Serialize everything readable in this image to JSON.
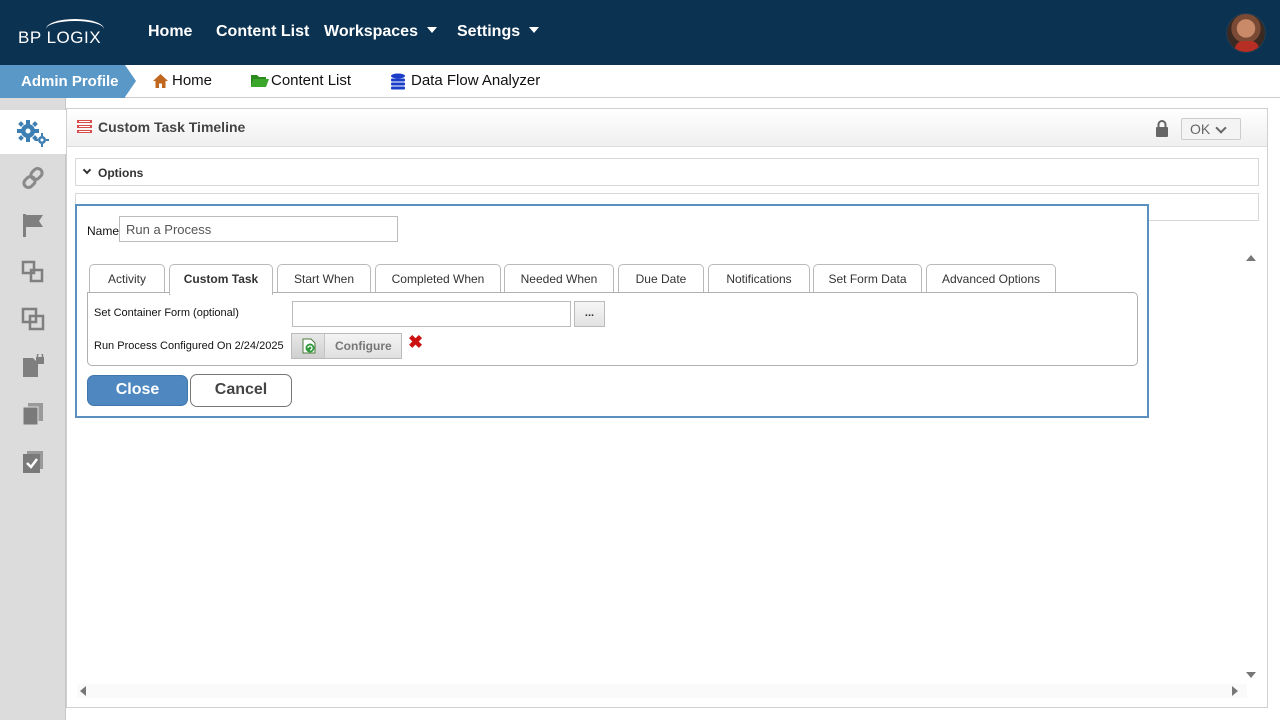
{
  "topnav": {
    "logo_text": "BP LOGIX",
    "items": [
      {
        "label": "Home"
      },
      {
        "label": "Content List"
      },
      {
        "label": "Workspaces"
      },
      {
        "label": "Settings"
      }
    ]
  },
  "breadcrumb": {
    "profile": "Admin Profile",
    "items": [
      {
        "label": "Home",
        "icon": "home-icon"
      },
      {
        "label": "Content List",
        "icon": "folder-open-icon"
      },
      {
        "label": "Data Flow Analyzer",
        "icon": "database-icon"
      }
    ]
  },
  "sidebar": {
    "icons": [
      "gears-icon",
      "link-icon",
      "flag-icon",
      "move-icon",
      "copy-layers-icon",
      "locked-document-icon",
      "documents-icon",
      "checked-document-icon"
    ]
  },
  "panel": {
    "title": "Custom Task Timeline",
    "ok_label": "OK",
    "options_label": "Options"
  },
  "dialog": {
    "name_label": "Name",
    "name_value": "Run a Process",
    "tabs": [
      {
        "label": "Activity"
      },
      {
        "label": "Custom Task",
        "active": true
      },
      {
        "label": "Start When"
      },
      {
        "label": "Completed When"
      },
      {
        "label": "Needed When"
      },
      {
        "label": "Due Date"
      },
      {
        "label": "Notifications"
      },
      {
        "label": "Set Form Data"
      },
      {
        "label": "Advanced Options"
      }
    ],
    "container_form_label": "Set Container Form (optional)",
    "container_form_value": "",
    "browse_label": "...",
    "run_process_label": "Run Process Configured On 2/24/2025",
    "configure_label": "Configure",
    "remove_symbol": "✖",
    "close_label": "Close",
    "cancel_label": "Cancel"
  },
  "colors": {
    "topnav_bg": "#0c3251",
    "accent_blue": "#5a98c8",
    "dialog_border": "#5a8fbf",
    "close_button": "#4f88c0",
    "remove_red": "#cc1111"
  }
}
